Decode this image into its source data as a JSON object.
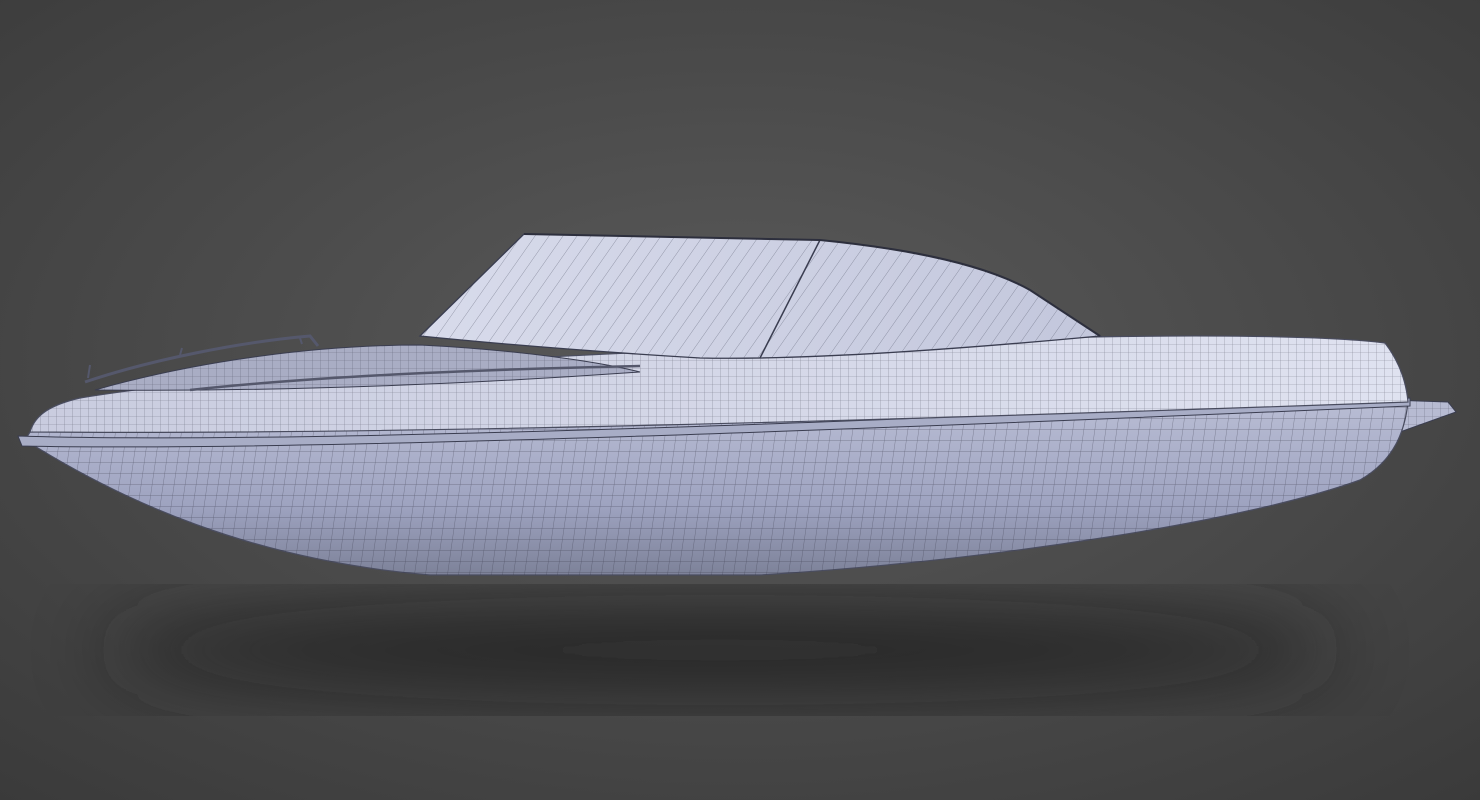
{
  "scene": {
    "subject": "speedboat-wireframe",
    "colors": {
      "background_center": "#5a5a5a",
      "background_edge": "#3c3c3c",
      "hull_light": "#d4d7e8",
      "hull_dark": "#8a8fab",
      "wire": "#2a2c3a"
    }
  }
}
